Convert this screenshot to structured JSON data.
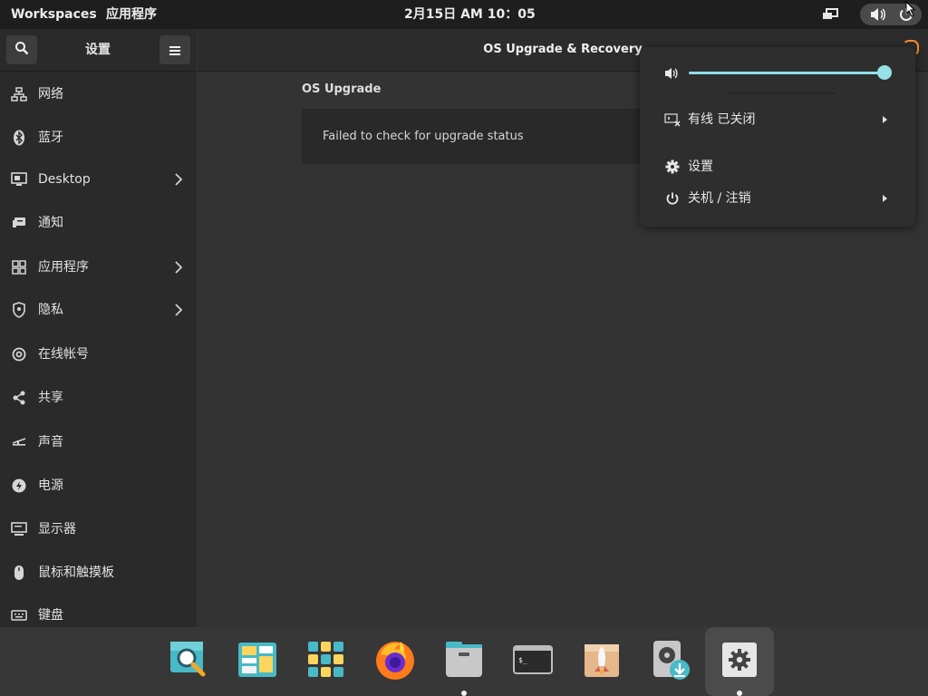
{
  "topbar": {
    "workspaces": "Workspaces",
    "apps": "应用程序",
    "clock": "2月15日  AM 10：05",
    "icons": [
      "display-icon",
      "volume-icon",
      "power-icon"
    ]
  },
  "settings": {
    "title": "设置",
    "items": [
      {
        "label": "网络",
        "icon": "network-icon",
        "chevron": false
      },
      {
        "label": "蓝牙",
        "icon": "bluetooth-icon",
        "chevron": false
      },
      {
        "label": "Desktop",
        "icon": "desktop-icon",
        "chevron": true
      },
      {
        "label": "通知",
        "icon": "notification-icon",
        "chevron": false
      },
      {
        "label": "应用程序",
        "icon": "apps-grid-icon",
        "chevron": true
      },
      {
        "label": "隐私",
        "icon": "privacy-icon",
        "chevron": true
      },
      {
        "label": "在线帐号",
        "icon": "at-icon",
        "chevron": false
      },
      {
        "label": "共享",
        "icon": "share-icon",
        "chevron": false
      },
      {
        "label": "声音",
        "icon": "sound-icon",
        "chevron": false
      },
      {
        "label": "电源",
        "icon": "power-bolt-icon",
        "chevron": false
      },
      {
        "label": "显示器",
        "icon": "monitor-icon",
        "chevron": false
      },
      {
        "label": "鼠标和触摸板",
        "icon": "mouse-icon",
        "chevron": false
      },
      {
        "label": "键盘",
        "icon": "keyboard-icon",
        "chevron": false
      }
    ]
  },
  "main": {
    "title": "OS Upgrade & Recovery",
    "section": "OS Upgrade",
    "status": "Failed to check for upgrade status"
  },
  "popup": {
    "volume_percent": 100,
    "wired": "有线 已关闭",
    "settings": "设置",
    "power": "关机 / 注销"
  },
  "dock": {
    "apps": [
      "search-app-icon",
      "pop-shop-icon",
      "app-grid-icon",
      "firefox-icon",
      "files-icon",
      "terminal-icon",
      "rocket-icon",
      "disk-download-icon",
      "settings-app-icon"
    ],
    "running": [
      "files-icon",
      "settings-app-icon"
    ],
    "active": "settings-app-icon"
  },
  "colors": {
    "accent": "#94e2e8",
    "topbar": "#1e1e1e",
    "sidebar": "#2a2a2a",
    "content": "#333333",
    "popup": "#2e2e2e",
    "dock": "#373737"
  }
}
